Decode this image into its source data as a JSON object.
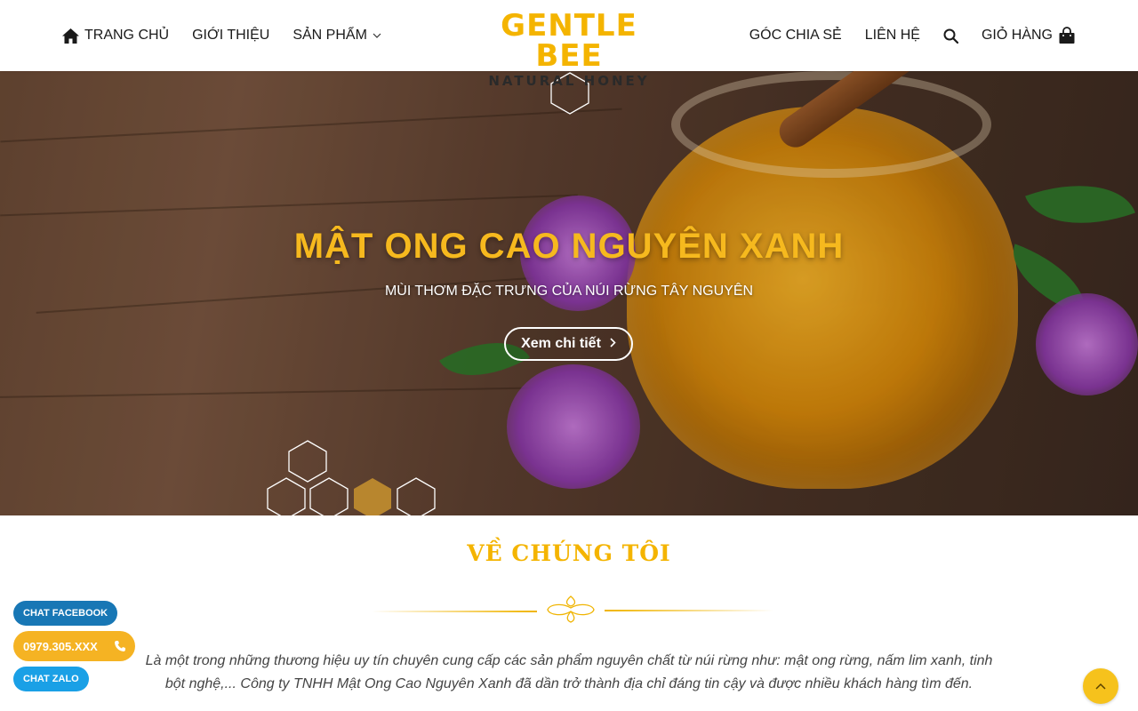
{
  "nav": {
    "home": "TRANG CHỦ",
    "about": "GIỚI THIỆU",
    "products": "SẢN PHẨM",
    "blog": "GÓC CHIA SẺ",
    "contact": "LIÊN HỆ",
    "cart": "GIỎ HÀNG"
  },
  "logo": {
    "title": "GENTLE BEE",
    "subtitle": "NATURAL HONEY"
  },
  "hero": {
    "title": "MẬT ONG CAO NGUYÊN XANH",
    "subtitle": "MÙI THƠM ĐẶC TRƯNG CỦA NÚI RỪNG TÂY NGUYÊN",
    "button": "Xem chi tiết"
  },
  "about": {
    "title": "VỀ CHÚNG TÔI",
    "text": "Là một trong những thương hiệu uy tín chuyên cung cấp các sản phẩm nguyên chất từ núi rừng như: mật ong rừng, nấm lim xanh, tinh bột nghệ,... Công ty TNHH Mật Ong Cao Nguyên Xanh đã dần trở thành địa chỉ đáng tin cậy và được nhiều khách hàng tìm đến."
  },
  "floating": {
    "facebook": "CHAT FACEBOOK",
    "phone": "0979.305.XXX",
    "zalo": "CHAT ZALO"
  },
  "colors": {
    "brand_yellow": "#f4b400",
    "facebook_blue": "#1877b5",
    "zalo_blue": "#1aa0e6"
  },
  "icons": [
    "home-icon",
    "chevron-down-icon",
    "search-icon",
    "shopping-bag-icon",
    "chevron-right-icon",
    "phone-icon",
    "arrow-up-icon"
  ]
}
